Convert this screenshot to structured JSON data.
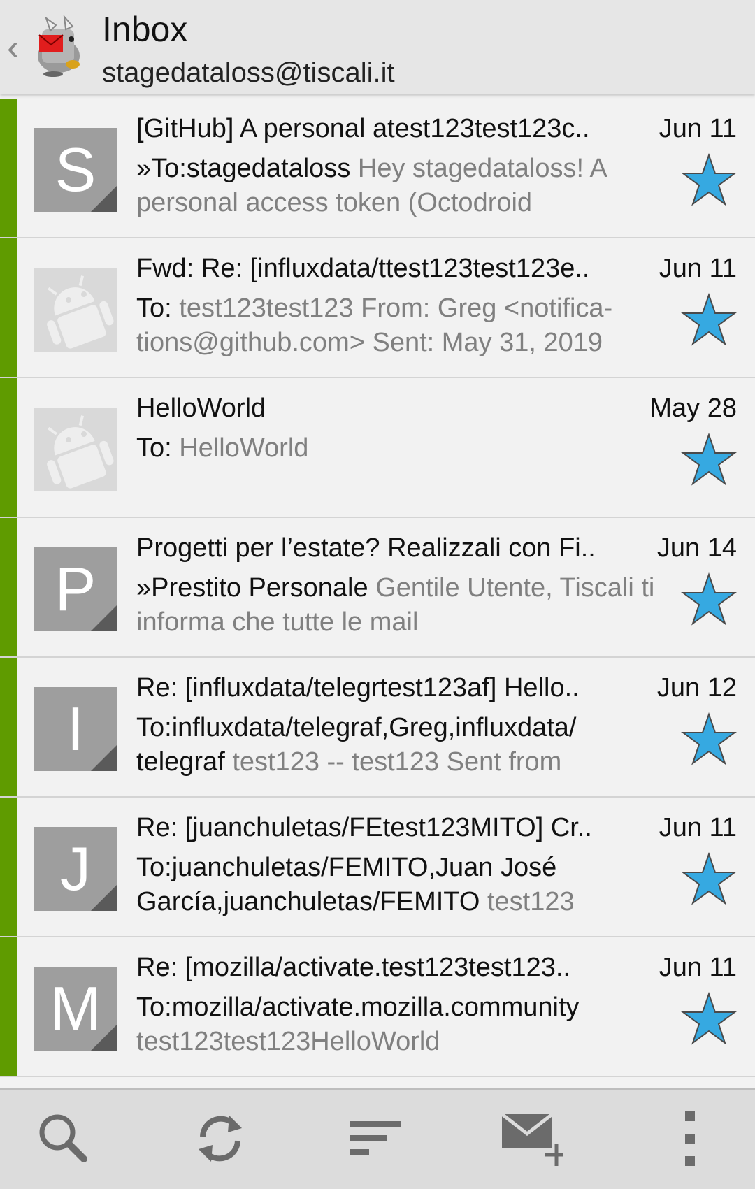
{
  "header": {
    "title": "Inbox",
    "account": "stagedataloss@tiscali.it"
  },
  "icons": {
    "back": "chevron-left-icon",
    "logo": "k9-mail-dog-icon",
    "star": "star-icon",
    "toolbar": [
      "search-icon",
      "refresh-icon",
      "sort-icon",
      "compose-icon",
      "overflow-menu-icon"
    ]
  },
  "colors": {
    "unread_bar": "#5f9b00",
    "star": "#36a9e1",
    "avatar_bg": "#9e9e9e"
  },
  "messages": [
    {
      "avatar_letter": "S",
      "subject": "[GitHub] A personal atest123test123c..",
      "date": "Jun 11",
      "sender": "»To:stagedataloss",
      "preview": "Hey stagedataloss! A personal access token (Octodroid"
    },
    {
      "avatar_letter": "",
      "subject": "Fwd: Re: [influxdata/ttest123test123e..",
      "date": "Jun 11",
      "sender": "To:",
      "preview": "test123test123 From: Greg <notifica-tions@github.com> Sent: May 31, 2019"
    },
    {
      "avatar_letter": "",
      "subject": "HelloWorld",
      "date": "May 28",
      "sender": "To:",
      "preview": "HelloWorld"
    },
    {
      "avatar_letter": "P",
      "subject": "Progetti per l’estate? Realizzali con Fi..",
      "date": "Jun 14",
      "sender": "»Prestito Personale",
      "preview": "Gentile Utente, Tiscali ti informa che tutte le mail"
    },
    {
      "avatar_letter": "I",
      "subject": "Re: [influxdata/telegrtest123af] Hello..",
      "date": "Jun 12",
      "sender": "To:influxdata/telegraf,Greg,influxdata/ telegraf",
      "preview": "test123 -- test123 Sent from"
    },
    {
      "avatar_letter": "J",
      "subject": "Re: [juanchuletas/FEtest123MITO] Cr..",
      "date": "Jun 11",
      "sender": "To:juanchuletas/FEMITO,Juan José García,juanchuletas/FEMITO",
      "preview": "test123"
    },
    {
      "avatar_letter": "M",
      "subject": "Re: [mozilla/activate.test123test123..",
      "date": "Jun 11",
      "sender": "To:mozilla/activate.mozilla.community",
      "preview": "test123test123HelloWorld"
    }
  ]
}
